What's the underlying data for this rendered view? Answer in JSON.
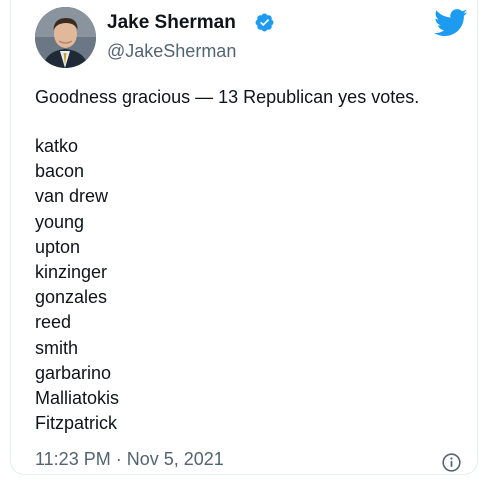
{
  "author": {
    "name": "Jake Sherman",
    "handle": "@JakeSherman",
    "verified": true,
    "avatar_icon": "profile-photo"
  },
  "tweet": {
    "headline": "Goodness gracious — 13 Republican yes votes.",
    "names": [
      "katko",
      "bacon",
      "van drew",
      "young",
      "upton",
      "kinzinger",
      "gonzales",
      "reed",
      "smith",
      "garbarino",
      "Malliatokis",
      "Fitzpatrick"
    ],
    "timestamp": "11:23 PM · Nov 5, 2021"
  },
  "icons": {
    "brand": "twitter-bird-icon",
    "verified": "verified-badge-icon",
    "info": "info-icon"
  },
  "colors": {
    "brand_blue": "#1d9bf0",
    "text": "#0f1419",
    "secondary_text": "#536471"
  }
}
